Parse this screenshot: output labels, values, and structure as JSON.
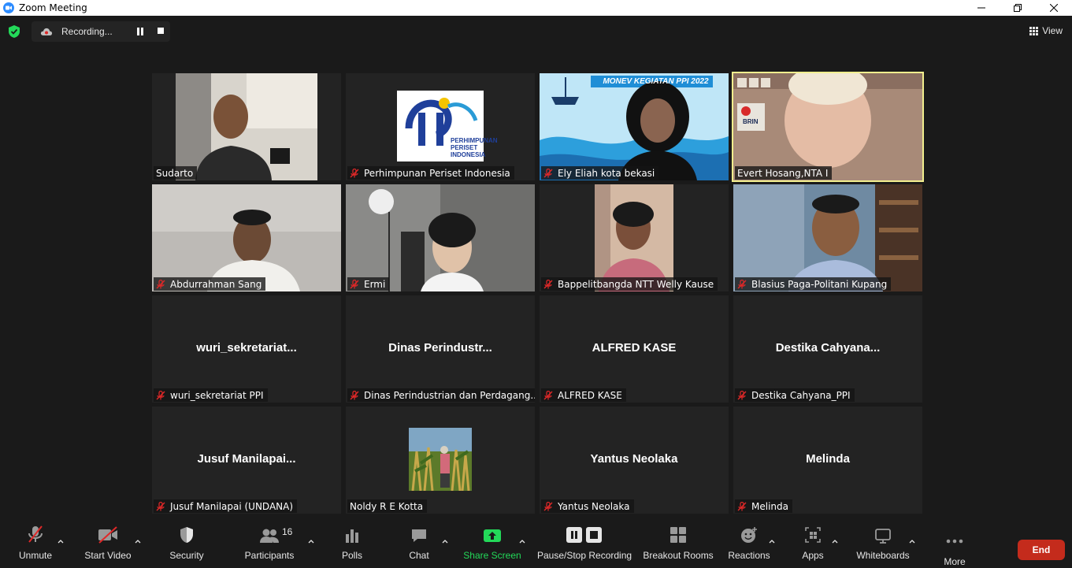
{
  "window": {
    "title": "Zoom Meeting"
  },
  "topbar": {
    "recording_label": "Recording...",
    "view_label": "View"
  },
  "participants": [
    {
      "name": "Sudarto",
      "muted": false,
      "video": true
    },
    {
      "name": "Perhimpunan Periset Indonesia",
      "muted": true,
      "video": true,
      "logo_text": "PERHIMPUNAN PERISET INDONESIA"
    },
    {
      "name": "Ely Eliah  kota bekasi",
      "muted": true,
      "video": true,
      "banner_text": "MONEV KEGIATAN PPI 2022"
    },
    {
      "name": "Evert Hosang,NTA I",
      "muted": false,
      "video": true,
      "active_speaker": true,
      "sign_text": "BRIN"
    },
    {
      "name": "Abdurrahman Sang",
      "muted": true,
      "video": true
    },
    {
      "name": "Ermi",
      "muted": true,
      "video": true
    },
    {
      "name": "Bappelitbangda NTT Welly Kause",
      "muted": true,
      "video": true
    },
    {
      "name": "Blasius Paga-Politani Kupang",
      "muted": true,
      "video": true
    },
    {
      "name": "wuri_sekretariat PPI",
      "display": "wuri_sekretariat...",
      "muted": true,
      "video": false
    },
    {
      "name": "Dinas Perindustrian dan Perdagang...",
      "display": "Dinas  Perindustr...",
      "muted": true,
      "video": false
    },
    {
      "name": "ALFRED KASE",
      "display": "ALFRED KASE",
      "muted": true,
      "video": false
    },
    {
      "name": "Destika Cahyana_PPI",
      "display": "Destika  Cahyana...",
      "muted": true,
      "video": false
    },
    {
      "name": "Jusuf Manilapai (UNDANA)",
      "display": "Jusuf  Manilapai...",
      "muted": true,
      "video": false
    },
    {
      "name": "Noldy R E Kotta",
      "muted": false,
      "video": false,
      "has_avatar": true
    },
    {
      "name": "Yantus Neolaka",
      "display": "Yantus Neolaka",
      "muted": true,
      "video": false
    },
    {
      "name": "Melinda",
      "display": "Melinda",
      "muted": true,
      "video": false
    }
  ],
  "toolbar": {
    "unmute": "Unmute",
    "start_video": "Start Video",
    "security": "Security",
    "participants": "Participants",
    "participants_count": "16",
    "polls": "Polls",
    "chat": "Chat",
    "share_screen": "Share Screen",
    "pause_stop_recording": "Pause/Stop Recording",
    "breakout_rooms": "Breakout Rooms",
    "reactions": "Reactions",
    "apps": "Apps",
    "whiteboards": "Whiteboards",
    "more": "More",
    "end": "End"
  },
  "colors": {
    "active_speaker": "#f1ee8e",
    "share_green": "#23d959",
    "end_red": "#c42b1c",
    "mute_red": "#e02828"
  }
}
